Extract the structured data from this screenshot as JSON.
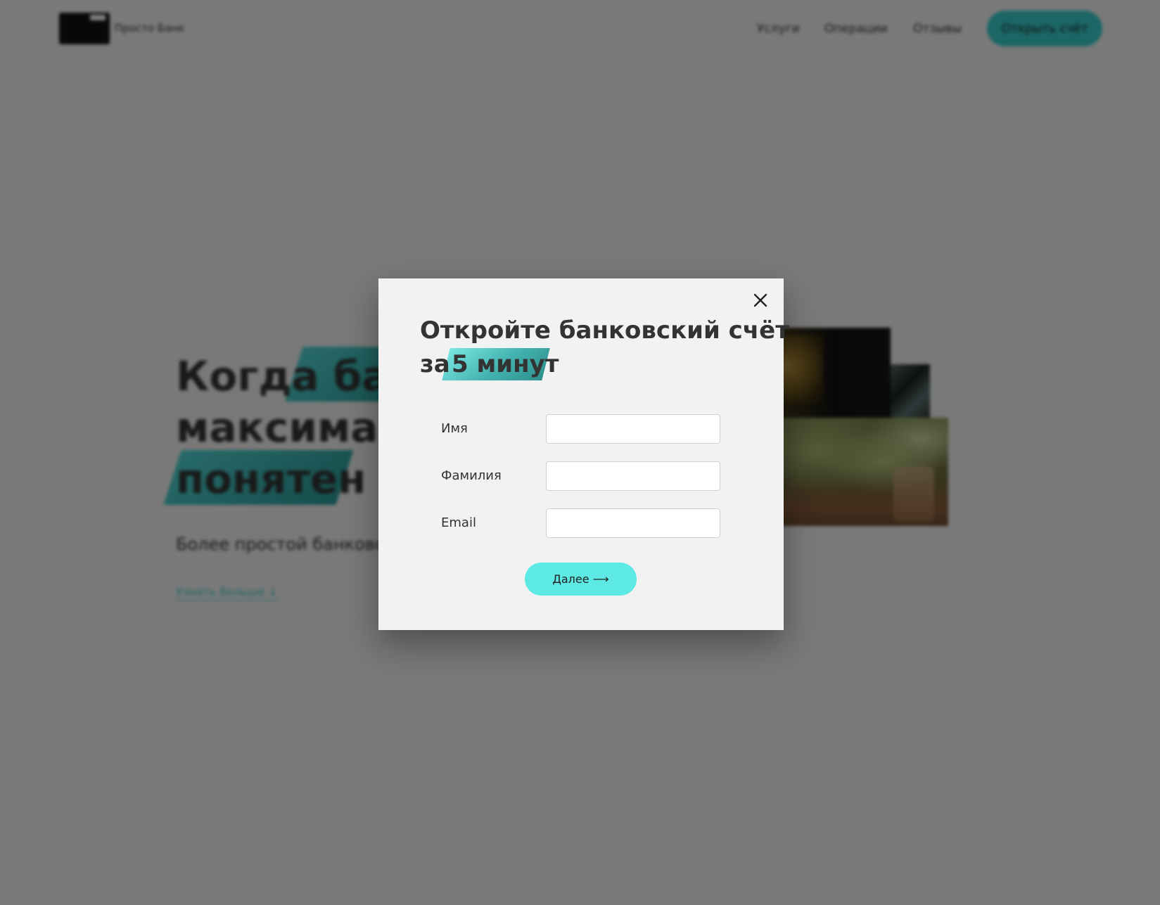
{
  "header": {
    "logo_text": "Просто Банк",
    "nav": [
      "Услуги",
      "Операции",
      "Отзывы"
    ],
    "cta_label": "Открыть счёт"
  },
  "hero": {
    "title_lines": [
      "Когда банк",
      "максимально",
      "понятен"
    ],
    "subtitle": "Более простой банковский",
    "link_label": "Узнать больше ↓"
  },
  "modal": {
    "title_line1": "Откройте банковский счёт",
    "title_line2_prefix": "за",
    "title_highlight": "5 минут",
    "fields": [
      {
        "label": "Имя",
        "value": ""
      },
      {
        "label": "Фамилия",
        "value": ""
      },
      {
        "label": "Email",
        "value": ""
      }
    ],
    "submit_label": "Далее ⟶"
  },
  "colors": {
    "accent": "#5eeae4",
    "accent_dark": "#39cccc",
    "overlay": "rgba(0,0,0,0.5)",
    "modal_bg": "#f2f2f2"
  },
  "icons": {
    "close": "close-icon"
  }
}
